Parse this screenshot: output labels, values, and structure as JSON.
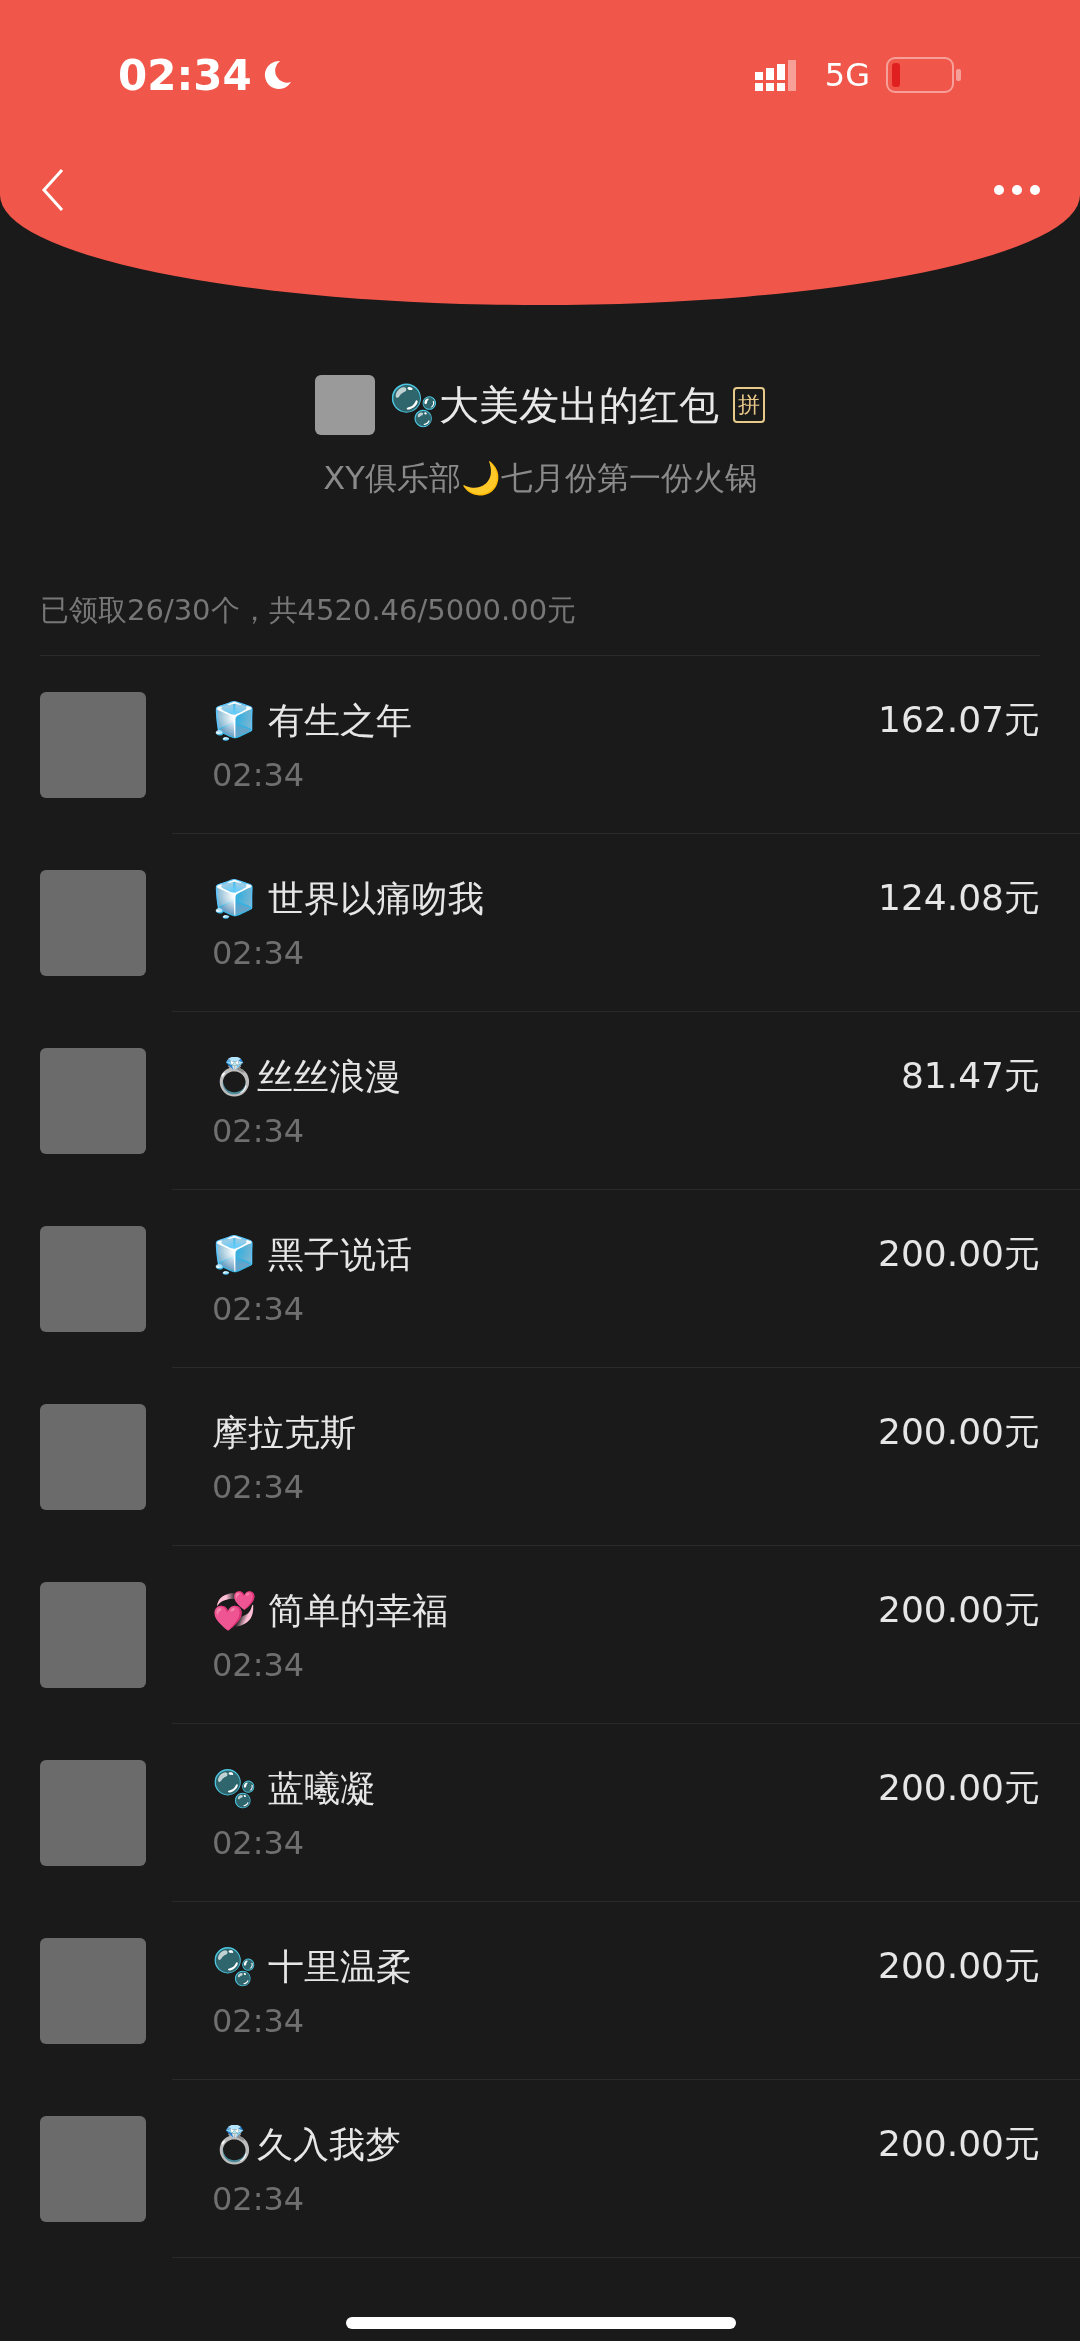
{
  "status_bar": {
    "time": "02:34",
    "network": "5G"
  },
  "envelope": {
    "title": "🫧大美发出的红包",
    "badge": "拼",
    "message": "XY俱乐部🌙七月份第一份火锅"
  },
  "summary": "已领取26/30个，共4520.46/5000.00元",
  "recipients": [
    {
      "name": "🧊 有生之年",
      "time": "02:34",
      "amount": "162.07元"
    },
    {
      "name": "🧊 世界以痛吻我",
      "time": "02:34",
      "amount": "124.08元"
    },
    {
      "name": "💍丝丝浪漫",
      "time": "02:34",
      "amount": "81.47元"
    },
    {
      "name": "🧊 黑子说话",
      "time": "02:34",
      "amount": "200.00元"
    },
    {
      "name": "摩拉克斯",
      "time": "02:34",
      "amount": "200.00元"
    },
    {
      "name": "💞 简单的幸福",
      "time": "02:34",
      "amount": "200.00元"
    },
    {
      "name": "🫧 蓝曦凝",
      "time": "02:34",
      "amount": "200.00元"
    },
    {
      "name": "🫧 十里温柔",
      "time": "02:34",
      "amount": "200.00元"
    },
    {
      "name": "💍久入我梦",
      "time": "02:34",
      "amount": "200.00元"
    }
  ]
}
